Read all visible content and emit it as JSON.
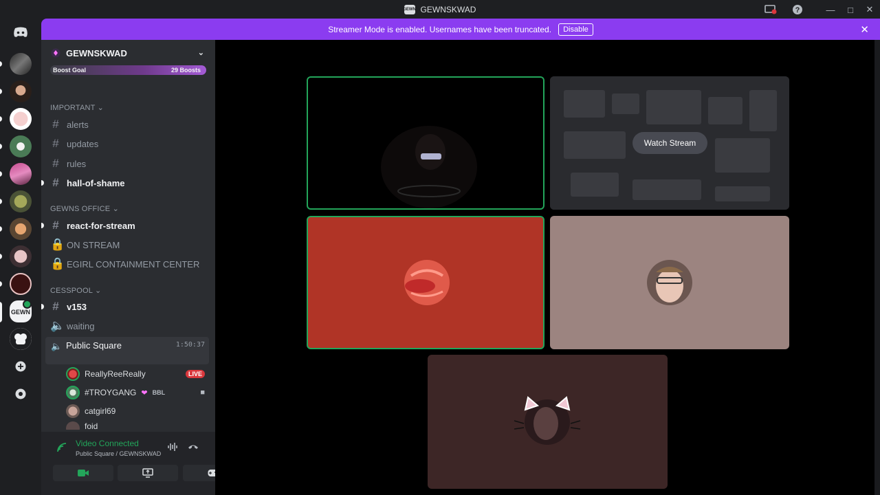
{
  "window": {
    "title": "GEWNSKWAD",
    "server_icon_text": "GEWN"
  },
  "banner": {
    "text": "Streamer Mode is enabled. Usernames have been truncated.",
    "disable_label": "Disable",
    "close_icon": "close-icon"
  },
  "guild": {
    "name": "GEWNSKWAD",
    "boost_goal": "Boost Goal",
    "boost_count": "29 Boosts"
  },
  "categories": {
    "important": "IMPORTANT",
    "gewns_office": "GEWNS OFFICE",
    "cesspool": "CESSPOOL"
  },
  "channels": {
    "alerts": "alerts",
    "updates": "updates",
    "rules": "rules",
    "hall_of_shame": "hall-of-shame",
    "react_for_stream": "react-for-stream",
    "on_stream": "ON STREAM",
    "egirl": "EGIRL CONTAINMENT CENTER",
    "v153": "v153",
    "waiting": "waiting"
  },
  "voice": {
    "channel": "Public Square",
    "timer": "1:50:37",
    "users": [
      {
        "name": "ReallyReeReally",
        "badge": "LIVE",
        "color": "#d73a3a"
      },
      {
        "name": "#TROYGANG",
        "tag": "BBL",
        "color": "#4a7a5a"
      },
      {
        "name": "catgirl69",
        "color": "#8a6f66"
      },
      {
        "name": "foid",
        "color": "#5a4a4a"
      }
    ]
  },
  "connection": {
    "status": "Video Connected",
    "location": "Public Square / GEWNSKWAD"
  },
  "stage": {
    "watch_stream": "Watch Stream"
  },
  "colors": {
    "accent": "#8b3cf0",
    "online": "#23a55a",
    "live": "#da373c"
  }
}
